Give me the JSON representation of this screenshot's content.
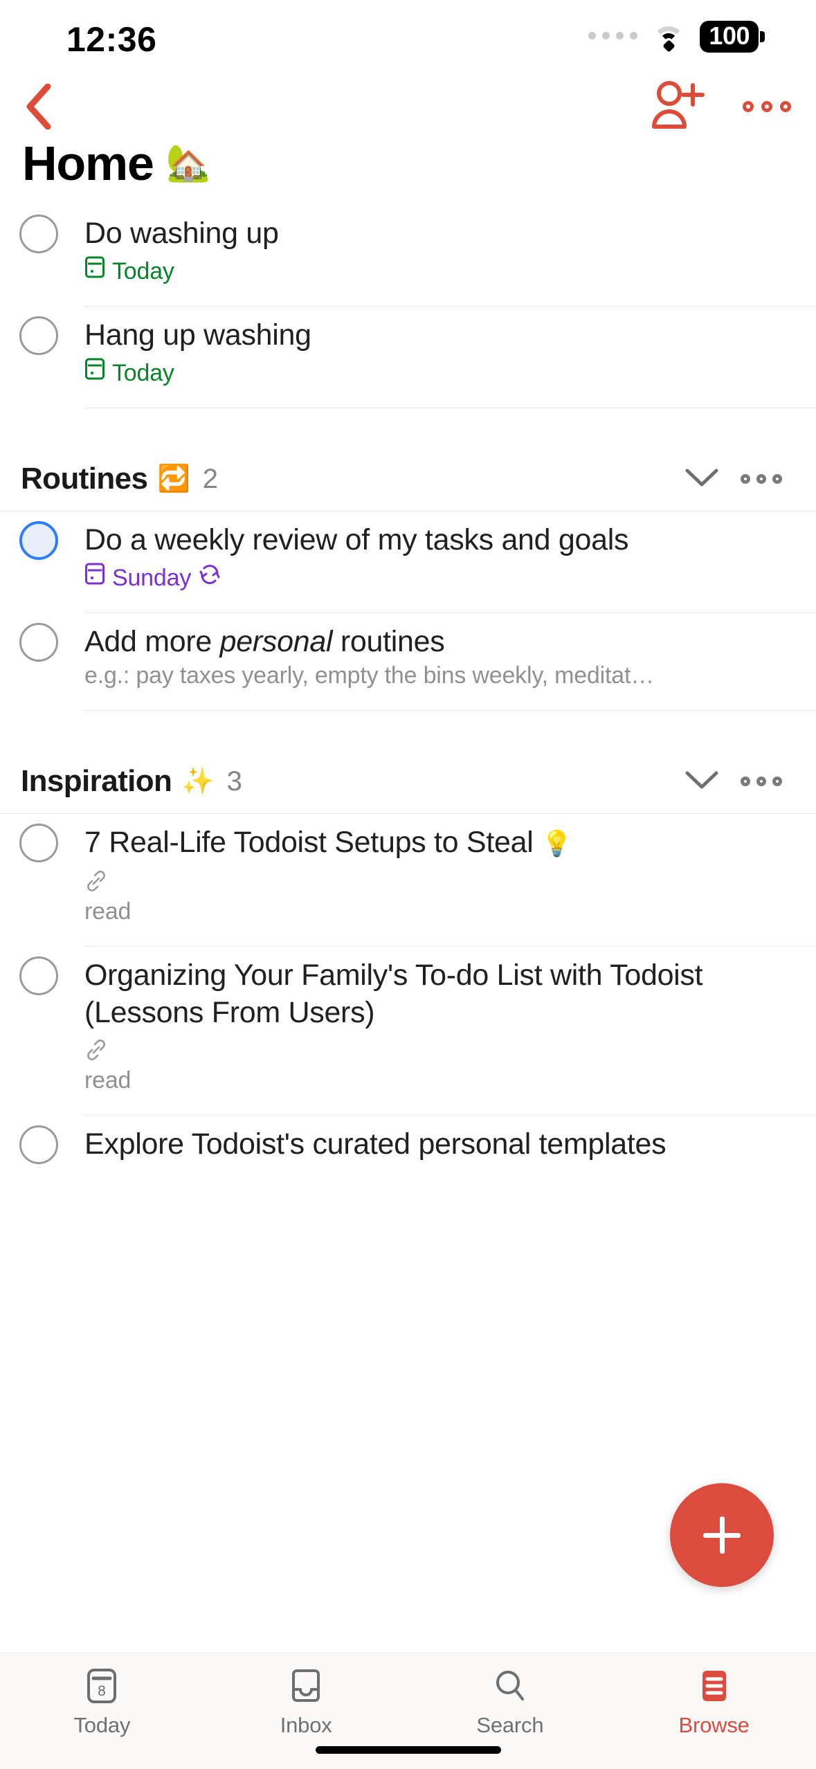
{
  "status_bar": {
    "time": "12:36",
    "battery_percent": "100",
    "wifi_icon": "wifi-icon",
    "signal_icon": "signal-dots-icon"
  },
  "nav_bar": {
    "back_icon": "chevron-left-icon",
    "add_person_icon": "person-add-icon",
    "more_icon": "more-horizontal-icon"
  },
  "header": {
    "title": "Home",
    "emoji": "🏡"
  },
  "top_tasks": [
    {
      "title": "Do washing up",
      "date": "Today",
      "date_icon": "calendar-icon",
      "checkbox": "checkbox-empty"
    },
    {
      "title": "Hang up washing",
      "date": "Today",
      "date_icon": "calendar-icon",
      "checkbox": "checkbox-empty"
    }
  ],
  "sections": [
    {
      "name": "Routines",
      "emoji": "🔁",
      "count": "2",
      "collapse_icon": "chevron-down-icon",
      "more_icon": "more-horizontal-icon",
      "tasks": [
        {
          "title": "Do a weekly review of my tasks and goals",
          "date": "Sunday",
          "date_icon": "calendar-icon",
          "recurring_icon": "↻",
          "checkbox": "checkbox-empty-selected"
        },
        {
          "title_pre": "Add more ",
          "title_em": "personal",
          "title_post": " routines",
          "subtitle": "e.g.: pay taxes yearly, empty the bins weekly, meditat…",
          "checkbox": "checkbox-empty"
        }
      ]
    },
    {
      "name": "Inspiration",
      "emoji": "✨",
      "count": "3",
      "collapse_icon": "chevron-down-icon",
      "more_icon": "more-horizontal-icon",
      "tasks": [
        {
          "title": "7 Real-Life Todoist Setups to Steal",
          "emoji": "💡",
          "link_icon": "link-icon",
          "label": "read",
          "checkbox": "checkbox-empty"
        },
        {
          "title": "Organizing Your Family's To-do List with Todoist (Lessons From Users)",
          "link_icon": "link-icon",
          "label": "read",
          "checkbox": "checkbox-empty"
        },
        {
          "title": "Explore Todoist's curated personal templates",
          "checkbox": "checkbox-empty"
        }
      ]
    }
  ],
  "fab": {
    "icon": "plus-icon",
    "label": "Add task"
  },
  "tab_bar": {
    "items": [
      {
        "label": "Today",
        "icon": "calendar-today-icon",
        "active": false
      },
      {
        "label": "Inbox",
        "icon": "inbox-icon",
        "active": false
      },
      {
        "label": "Search",
        "icon": "search-icon",
        "active": false
      },
      {
        "label": "Browse",
        "icon": "browse-menu-icon",
        "active": true
      }
    ]
  },
  "colors": {
    "accent_red": "#dc4c3e",
    "date_green": "#058527",
    "date_purple": "#7b2fd6",
    "checkbox_blue": "#2b7fff"
  }
}
